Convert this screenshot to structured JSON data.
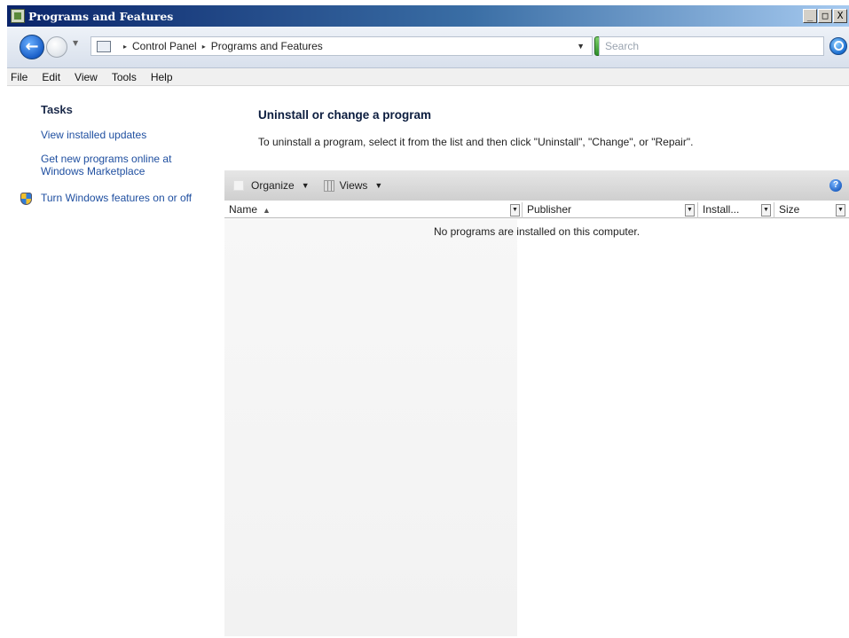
{
  "window": {
    "title": "Programs and Features",
    "controls": [
      "_",
      "□",
      "X"
    ]
  },
  "nav": {
    "breadcrumb": [
      "Control Panel",
      "Programs and Features"
    ],
    "search_placeholder": "Search"
  },
  "menu": [
    "File",
    "Edit",
    "View",
    "Tools",
    "Help"
  ],
  "tasks": {
    "title": "Tasks",
    "links": [
      "View installed updates",
      "Get new programs online at Windows Marketplace",
      "Turn Windows features on or off"
    ]
  },
  "main": {
    "title": "Uninstall or change a program",
    "description": "To uninstall a program, select it from the list and then click \"Uninstall\", \"Change\", or \"Repair\"."
  },
  "toolbar": {
    "organize": "Organize",
    "views": "Views"
  },
  "columns": [
    "Name",
    "Publisher",
    "Install...",
    "Size"
  ],
  "empty_message": "No programs are installed on this computer."
}
